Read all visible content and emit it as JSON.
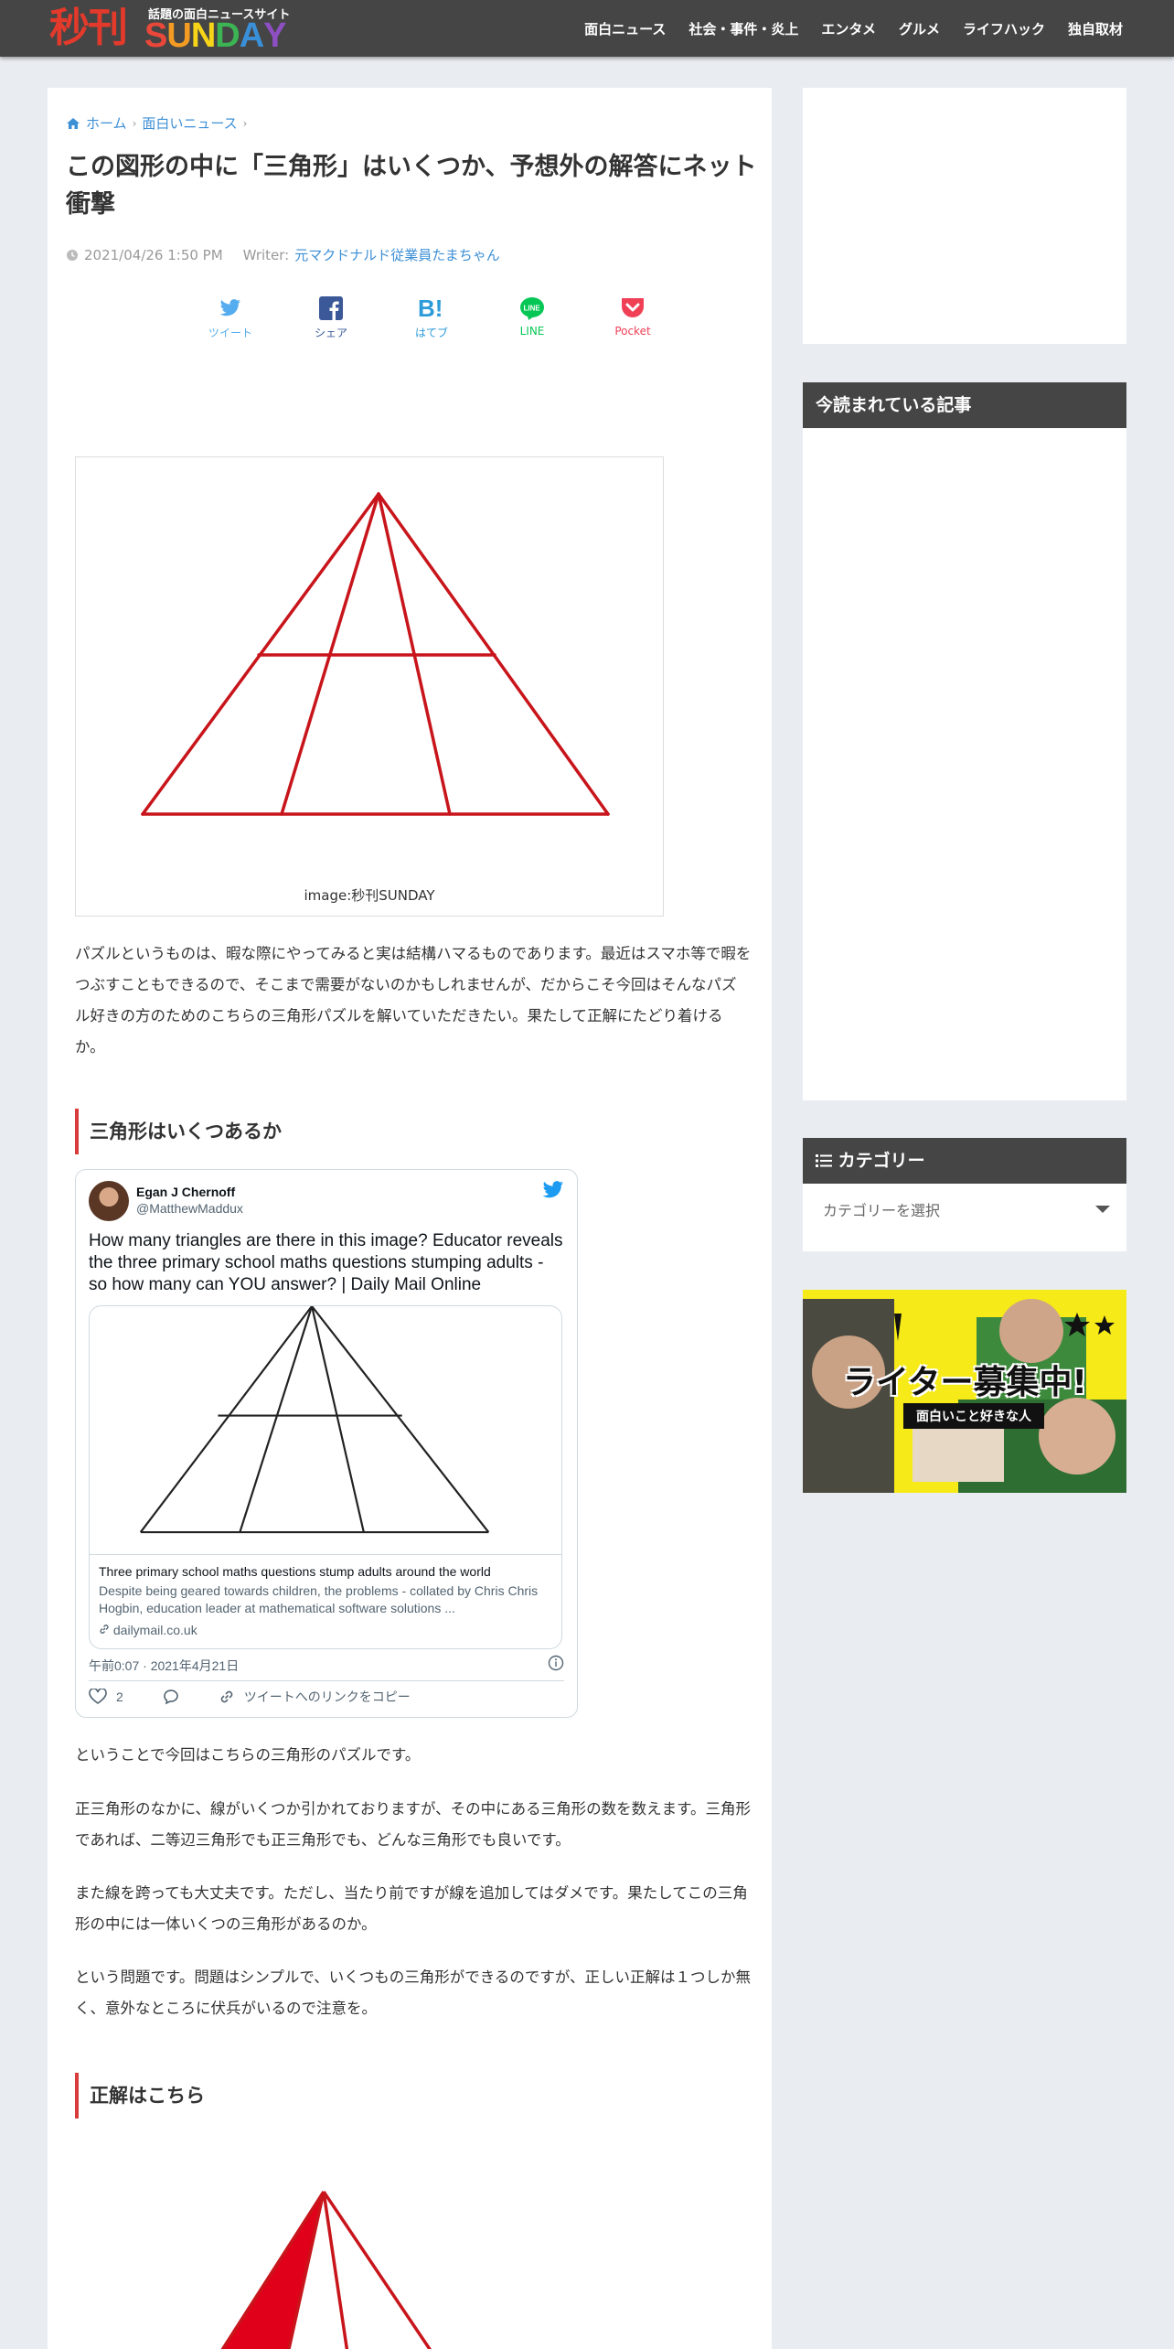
{
  "header": {
    "logo_kanji": "秒刊",
    "logo_tagline": "話題の面白ニュースサイト",
    "logo_word": [
      "S",
      "U",
      "N",
      "D",
      "A",
      "Y"
    ],
    "logo_colors": [
      "#e8473a",
      "#f39b22",
      "#f7d418",
      "#3cb454",
      "#3a8fd9",
      "#8e4fc2"
    ],
    "nav": [
      "面白ニュース",
      "社会・事件・炎上",
      "エンタメ",
      "グルメ",
      "ライフハック",
      "独自取材"
    ]
  },
  "breadcrumb": {
    "home": "ホーム",
    "category": "面白いニュース"
  },
  "article": {
    "title": "この図形の中に「三角形」はいくつか、予想外の解答にネット衝撃",
    "date": "2021/04/26 1:50 PM",
    "writer_label": "Writer:",
    "writer": "元マクドナルド従業員たまちゃん",
    "share": [
      {
        "label": "ツイート",
        "color": "#55acee",
        "icon": "twitter-icon"
      },
      {
        "label": "シェア",
        "color": "#3b5998",
        "icon": "facebook-icon"
      },
      {
        "label": "はてブ",
        "color": "#2c9bd9",
        "icon": "hatena-icon"
      },
      {
        "label": "LINE",
        "color": "#06c755",
        "icon": "line-icon"
      },
      {
        "label": "Pocket",
        "color": "#ef4056",
        "icon": "pocket-icon"
      }
    ],
    "image_caption": "image:秒刊SUNDAY",
    "intro": "パズルというものは、暇な際にやってみると実は結構ハマるものであります。最近はスマホ等で暇をつぶすこともできるので、そこまで需要がないのかもしれませんが、だからこそ今回はそんなパズル好きの方のためのこちらの三角形パズルを解いていただきたい。果たして正解にたどり着けるか。",
    "heading1": "三角形はいくつあるか",
    "para1": "ということで今回はこちらの三角形のパズルです。",
    "para2": "正三角形のなかに、線がいくつか引かれておりますが、その中にある三角形の数を数えます。三角形であれば、二等辺三角形でも正三角形でも、どんな三角形でも良いです。",
    "para3": "また線を跨っても大丈夫です。ただし、当たり前ですが線を追加してはダメです。果たしてこの三角形の中には一体いくつの三角形があるのか。",
    "para4": "という問題です。問題はシンプルで、いくつもの三角形ができるのですが、正しい正解は１つしか無く、意外なところに伏兵がいるので注意を。",
    "heading2": "正解はこちら"
  },
  "tweet": {
    "name": "Egan J Chernoff",
    "handle": "@MatthewMaddux",
    "text": "How many triangles are there in this image? Educator reveals the three primary school maths questions stumping adults - so how many can YOU answer? | Daily Mail Online",
    "card_title": "Three primary school maths questions stump adults around the world",
    "card_desc": "Despite being geared towards children, the problems - collated by Chris Chris Hogbin, education leader at mathematical software solutions ...",
    "card_url": "dailymail.co.uk",
    "date": "午前0:07 · 2021年4月21日",
    "likes": "2",
    "copy_link": "ツイートへのリンクをコピー"
  },
  "sidebar": {
    "popular_title": "今読まれている記事",
    "category_title": "カテゴリー",
    "category_select": "カテゴリーを選択",
    "banner_text": "ライター募集中!",
    "banner_sub": "面白いこと好きな人"
  }
}
